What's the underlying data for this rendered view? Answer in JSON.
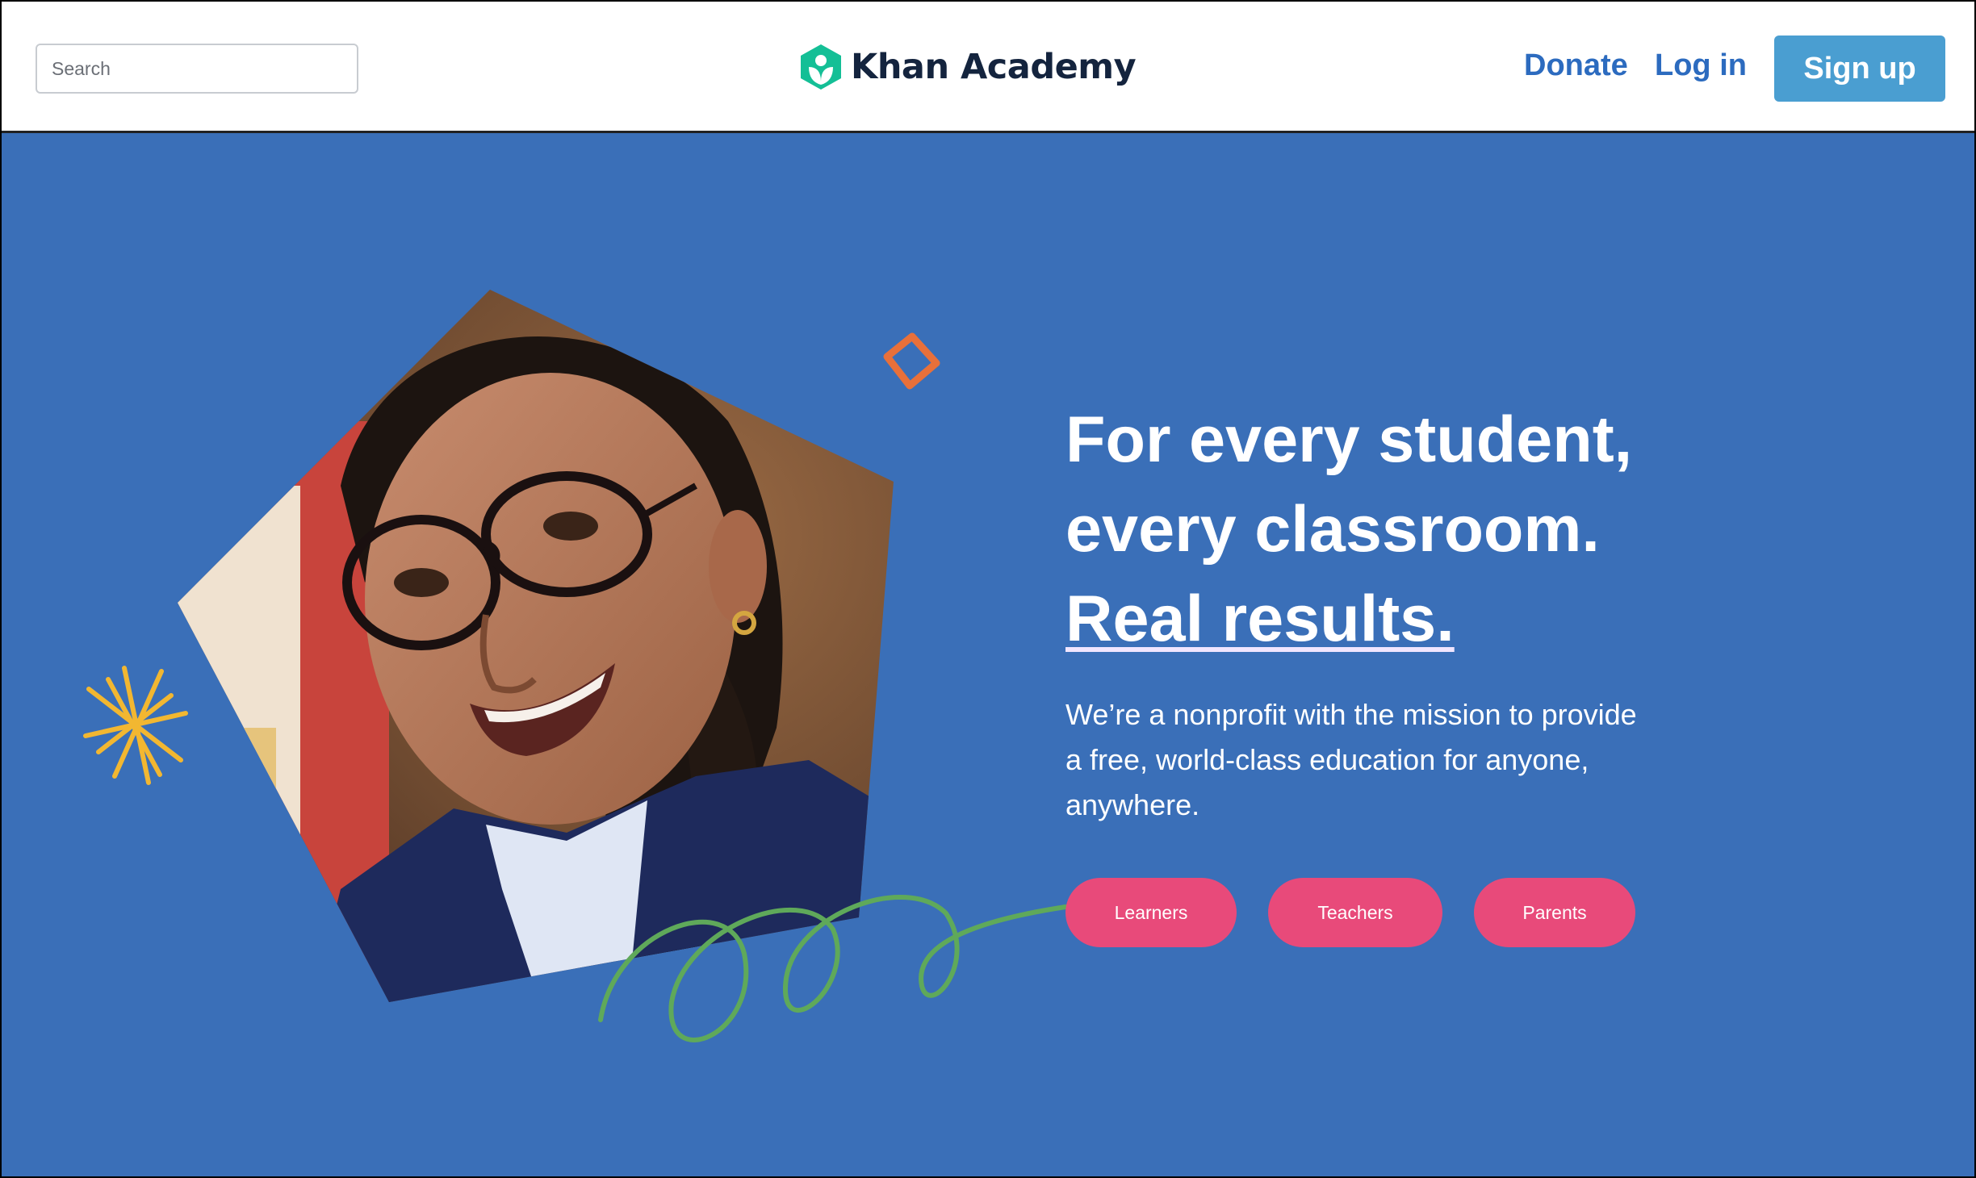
{
  "header": {
    "search_placeholder": "Search",
    "logo_text": "Khan Academy",
    "donate_label": "Donate",
    "login_label": "Log in",
    "signup_label": "Sign up"
  },
  "hero": {
    "headline_line1": "For every student,",
    "headline_line2": "every classroom.",
    "headline_accent": "Real results.",
    "mission": "We’re a nonprofit with the mission to provide a free, world-class education for anyone, anywhere.",
    "buttons": [
      {
        "label": "Learners"
      },
      {
        "label": "Teachers"
      },
      {
        "label": "Parents"
      }
    ]
  },
  "colors": {
    "hero_background": "#3a6fb8",
    "brand_green": "#14bf96",
    "link_blue": "#2c6bbf",
    "signup_blue": "#4a9ed1",
    "pill_pink": "#e84a7a",
    "doodle_orange": "#e8703a",
    "doodle_yellow": "#f2b731",
    "doodle_green": "#5fa95a"
  },
  "icons": [
    "khan-academy-logo-icon",
    "orange-diamond-doodle",
    "yellow-star-doodle",
    "green-squiggle-doodle",
    "student-photo"
  ]
}
